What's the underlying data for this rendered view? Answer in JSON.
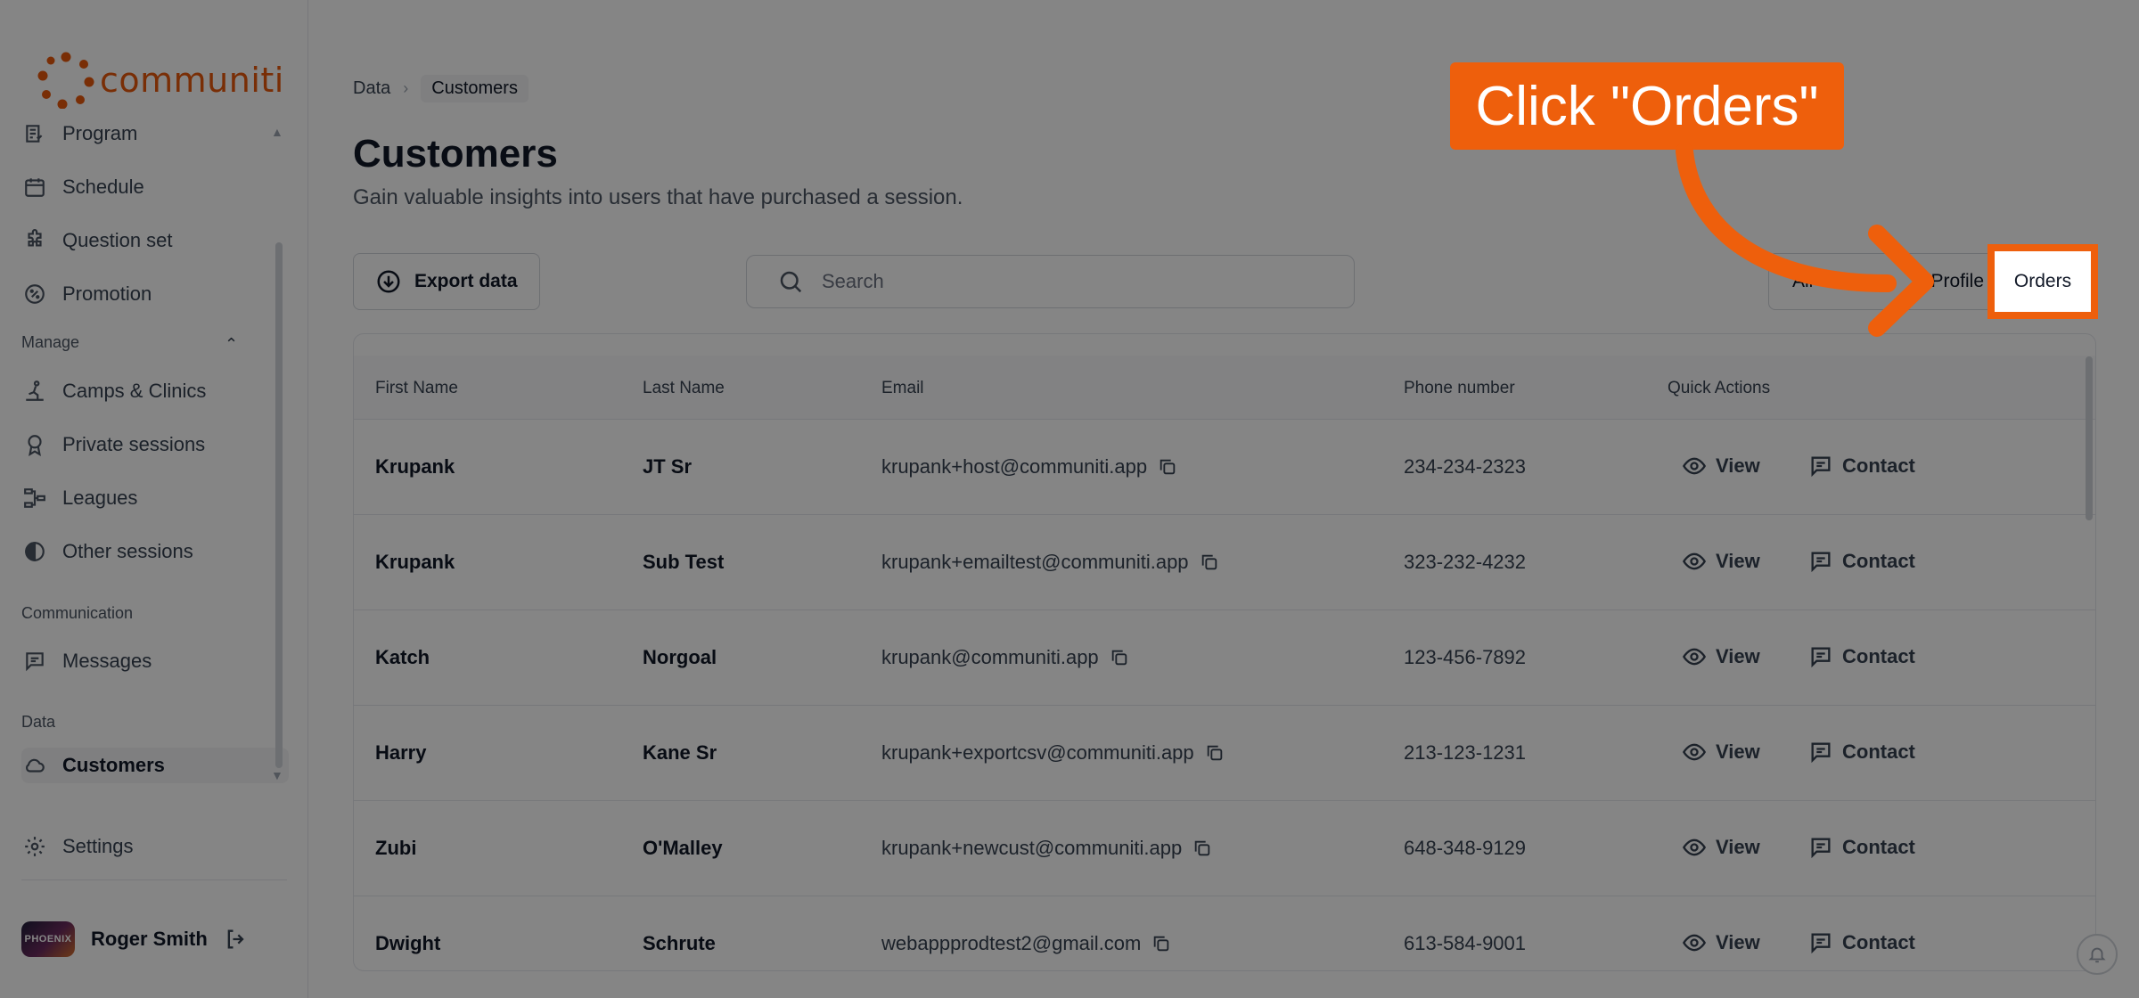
{
  "sidebar": {
    "brand": "communiti",
    "items": [
      {
        "label": "Program",
        "icon": "program-icon"
      },
      {
        "label": "Schedule",
        "icon": "calendar-icon"
      },
      {
        "label": "Question set",
        "icon": "puzzle-icon"
      },
      {
        "label": "Promotion",
        "icon": "percent-badge-icon"
      }
    ],
    "manage_section": "Manage",
    "manage_items": [
      {
        "label": "Camps & Clinics",
        "icon": "camps-icon"
      },
      {
        "label": "Private sessions",
        "icon": "award-icon"
      },
      {
        "label": "Leagues",
        "icon": "bracket-icon"
      },
      {
        "label": "Other sessions",
        "icon": "half-circle-icon"
      }
    ],
    "communication_section": "Communication",
    "communication_items": [
      {
        "label": "Messages",
        "icon": "message-icon"
      }
    ],
    "data_section": "Data",
    "data_items": [
      {
        "label": "Customers",
        "icon": "cloud-icon",
        "active": true
      }
    ],
    "settings_label": "Settings",
    "user": {
      "name": "Roger Smith",
      "avatar_text": "PHOENIX"
    }
  },
  "breadcrumb": {
    "parent": "Data",
    "current": "Customers"
  },
  "page": {
    "title": "Customers",
    "subtitle": "Gain valuable insights into users that have purchased a session."
  },
  "toolbar": {
    "export_label": "Export data",
    "search_placeholder": "Search",
    "segments": {
      "all": "All",
      "profile": "Profile",
      "orders": "Orders"
    }
  },
  "table": {
    "columns": [
      "First Name",
      "Last Name",
      "Email",
      "Phone number",
      "Quick Actions"
    ],
    "view_label": "View",
    "contact_label": "Contact",
    "rows": [
      {
        "first": "Krupank",
        "last": "JT Sr",
        "email": "krupank+host@communiti.app",
        "phone": "234-234-2323"
      },
      {
        "first": "Krupank",
        "last": "Sub Test",
        "email": "krupank+emailtest@communiti.app",
        "phone": "323-232-4232"
      },
      {
        "first": "Katch",
        "last": "Norgoal",
        "email": "krupank@communiti.app",
        "phone": "123-456-7892"
      },
      {
        "first": "Harry",
        "last": "Kane Sr",
        "email": "krupank+exportcsv@communiti.app",
        "phone": "213-123-1231"
      },
      {
        "first": "Zubi",
        "last": "O'Malley",
        "email": "krupank+newcust@communiti.app",
        "phone": "648-348-9129"
      },
      {
        "first": "Dwight",
        "last": "Schrute",
        "email": "webappprodtest2@gmail.com",
        "phone": "613-584-9001"
      }
    ]
  },
  "tutorial": {
    "callout_text": "Click \"Orders\"",
    "accent_color": "#ee5f0c"
  }
}
